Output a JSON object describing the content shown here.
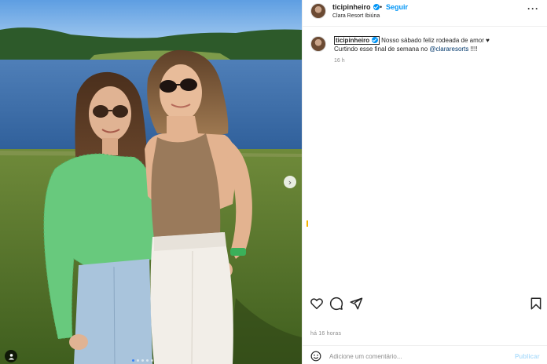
{
  "post": {
    "username": "ticipinheiro",
    "location": "Clara Resort Ibiúna",
    "follow_label": "Seguir",
    "separator": "•",
    "more_label": "···",
    "caption_line1": "Nosso sábado feliz rodeada de amor ♥",
    "caption_line2_prefix": "Curtindo esse final de semana no ",
    "caption_mention": "@clararesorts",
    "caption_line2_suffix": " !!!!",
    "caption_age": "16 h",
    "posted_ago": "há 16 horas"
  },
  "photo": {
    "carousel_next_icon": "chevron-right-icon",
    "tag_icon": "person-icon",
    "carousel_dot_count": 5,
    "carousel_active_index": 0
  },
  "actions": {
    "like_icon": "heart-icon",
    "comment_icon": "comment-icon",
    "share_icon": "send-icon",
    "save_icon": "bookmark-icon"
  },
  "comment_box": {
    "placeholder": "Adicione um comentário...",
    "publish_label": "Publicar",
    "emoji_icon": "smiley-icon"
  },
  "colors": {
    "accent_blue": "#0095f6",
    "publish_disabled": "#b2dffc",
    "secondary_text": "#8e8e8e",
    "mention": "#00376b"
  }
}
